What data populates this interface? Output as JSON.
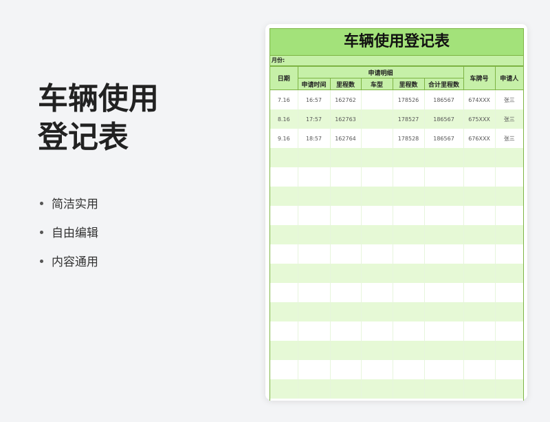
{
  "promo": {
    "title_line1": "车辆使用",
    "title_line2": "登记表",
    "features": [
      "简洁实用",
      "自由编辑",
      "内容通用"
    ]
  },
  "sheet": {
    "title": "车辆使用登记表",
    "month_label": "月份:",
    "headers": {
      "date": "日期",
      "detail_group": "申请明细",
      "plate": "车牌号",
      "applicant": "申请人",
      "sub": [
        "申请时间",
        "里程数",
        "车型",
        "里程数",
        "合计里程数"
      ]
    },
    "rows": [
      [
        "7.16",
        "16:57",
        "162762",
        "",
        "178526",
        "186567",
        "674XXX",
        "张三"
      ],
      [
        "8.16",
        "17:57",
        "162763",
        "",
        "178527",
        "186567",
        "675XXX",
        "张三"
      ],
      [
        "9.16",
        "18:57",
        "162764",
        "",
        "178528",
        "186567",
        "676XXX",
        "张三"
      ],
      [
        "",
        "",
        "",
        "",
        "",
        "",
        "",
        ""
      ],
      [
        "",
        "",
        "",
        "",
        "",
        "",
        "",
        ""
      ],
      [
        "",
        "",
        "",
        "",
        "",
        "",
        "",
        ""
      ],
      [
        "",
        "",
        "",
        "",
        "",
        "",
        "",
        ""
      ],
      [
        "",
        "",
        "",
        "",
        "",
        "",
        "",
        ""
      ],
      [
        "",
        "",
        "",
        "",
        "",
        "",
        "",
        ""
      ],
      [
        "",
        "",
        "",
        "",
        "",
        "",
        "",
        ""
      ],
      [
        "",
        "",
        "",
        "",
        "",
        "",
        "",
        ""
      ],
      [
        "",
        "",
        "",
        "",
        "",
        "",
        "",
        ""
      ],
      [
        "",
        "",
        "",
        "",
        "",
        "",
        "",
        ""
      ],
      [
        "",
        "",
        "",
        "",
        "",
        "",
        "",
        ""
      ],
      [
        "",
        "",
        "",
        "",
        "",
        "",
        "",
        ""
      ],
      [
        "",
        "",
        "",
        "",
        "",
        "",
        "",
        ""
      ]
    ]
  },
  "colors": {
    "title_bg": "#a3e27a",
    "header_bg": "#c6f0a8",
    "stripe": "#e6f9d6",
    "border": "#7cb342"
  }
}
